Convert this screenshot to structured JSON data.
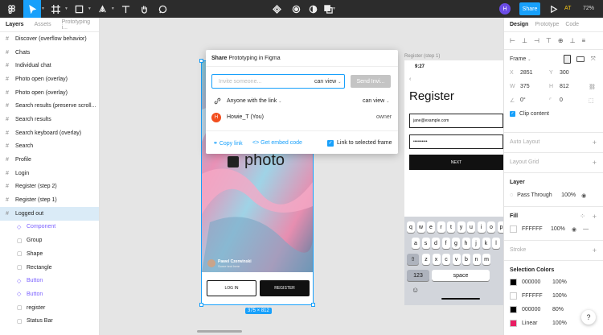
{
  "topbar": {
    "share": "Share",
    "zoom": "72%",
    "user_initials": "AT",
    "avatar": "H"
  },
  "left": {
    "tabs": [
      "Layers",
      "Assets",
      "Prototyping i..."
    ],
    "layers": [
      {
        "label": "Discover (overflow behavior)",
        "kind": "frame"
      },
      {
        "label": "Chats",
        "kind": "frame"
      },
      {
        "label": "Individual chat",
        "kind": "frame"
      },
      {
        "label": "Photo open (overlay)",
        "kind": "frame"
      },
      {
        "label": "Photo open (overlay)",
        "kind": "frame"
      },
      {
        "label": "Search results (preserve scroll...",
        "kind": "frame"
      },
      {
        "label": "Search results",
        "kind": "frame"
      },
      {
        "label": "Search keyboard (overlay)",
        "kind": "frame"
      },
      {
        "label": "Search",
        "kind": "frame"
      },
      {
        "label": "Profile",
        "kind": "frame"
      },
      {
        "label": "Login",
        "kind": "frame"
      },
      {
        "label": "Register (step 2)",
        "kind": "frame"
      },
      {
        "label": "Register (step 1)",
        "kind": "frame"
      },
      {
        "label": "Logged out",
        "kind": "frame",
        "selected": true
      },
      {
        "label": "Component",
        "kind": "comp"
      },
      {
        "label": "Group",
        "kind": "child"
      },
      {
        "label": "Shape",
        "kind": "child"
      },
      {
        "label": "Rectangle",
        "kind": "child"
      },
      {
        "label": "Button",
        "kind": "comp"
      },
      {
        "label": "Button",
        "kind": "comp"
      },
      {
        "label": "register",
        "kind": "child"
      },
      {
        "label": "Status Bar",
        "kind": "child"
      }
    ]
  },
  "dialog": {
    "title_prefix": "Share",
    "title_name": "Prototyping in Figma",
    "invite_placeholder": "Invite someone...",
    "can_view": "can view",
    "invite_button": "Send Invi...",
    "link_scope": "Anyone with the link",
    "link_perm": "can view",
    "owner_initial": "H",
    "owner_name": "Howie_T (You)",
    "owner_role": "owner",
    "copy_link": "Copy link",
    "embed": "Get embed code",
    "link_selected": "Link to selected frame"
  },
  "canvas": {
    "frame_label": "Register (step 1)",
    "size_badge": "375 × 812",
    "photo_logo": "photo",
    "author_name": "Pawel Czerwinski",
    "author_sub": "Some text here",
    "login": "LOG IN",
    "register": "REGISTER",
    "reg_time": "9:27",
    "reg_title": "Register",
    "reg_email": "jane@example.com",
    "reg_password": "••••••••••",
    "reg_next": "NEXT",
    "kb_row1": [
      "q",
      "w",
      "e",
      "r",
      "t",
      "y",
      "u",
      "i",
      "o",
      "p"
    ],
    "kb_row2": [
      "a",
      "s",
      "d",
      "f",
      "g",
      "h",
      "j",
      "k",
      "l"
    ],
    "kb_row3": [
      "z",
      "x",
      "c",
      "v",
      "b",
      "n",
      "m"
    ],
    "kb_123": "123",
    "kb_space": "space"
  },
  "right": {
    "tabs": [
      "Design",
      "Prototype",
      "Code"
    ],
    "frame": "Frame",
    "x": "2851",
    "y": "300",
    "w": "375",
    "h": "812",
    "rot": "0°",
    "radius": "0",
    "clip": "Clip content",
    "auto_layout": "Auto Layout",
    "layout_grid": "Layout Grid",
    "layer": "Layer",
    "blend": "Pass Through",
    "opacity": "100%",
    "fill": "Fill",
    "fill_hex": "FFFFFF",
    "fill_op": "100%",
    "stroke": "Stroke",
    "sel_colors": "Selection Colors",
    "colors": [
      {
        "hex": "000000",
        "op": "100%",
        "swatch": "#000000"
      },
      {
        "hex": "FFFFFF",
        "op": "100%",
        "swatch": "#ffffff"
      },
      {
        "hex": "000000",
        "op": "80%",
        "swatch": "#000000"
      },
      {
        "hex": "Linear",
        "op": "100%",
        "swatch": "#e91e63"
      }
    ]
  },
  "colors": {
    "accent": "#18a0fb",
    "topbar": "#2c2c2c",
    "selected_layer": "#daebf7",
    "component": "#7b61ff"
  }
}
